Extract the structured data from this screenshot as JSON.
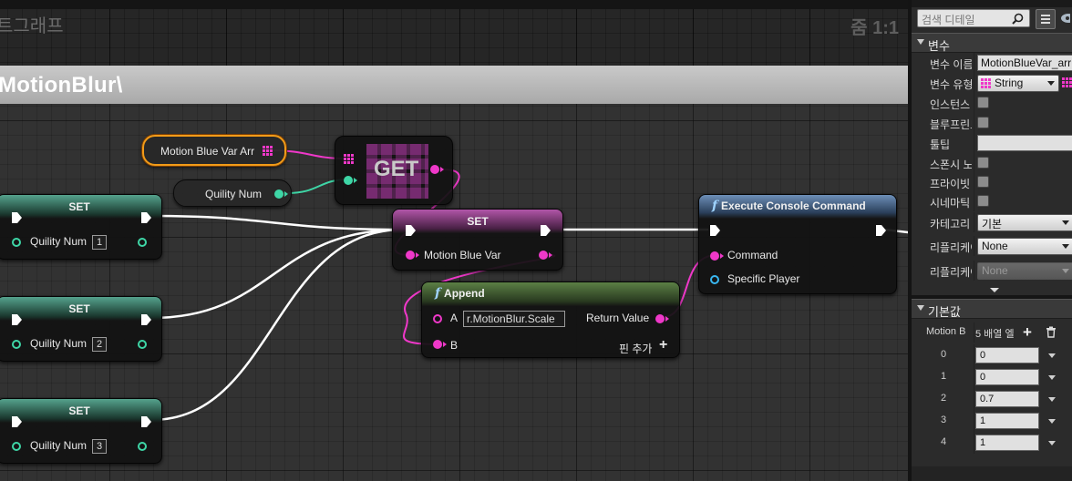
{
  "graph": {
    "title": "트그래프",
    "zoom": "줌 1:1",
    "comment": "MotionBlur\\"
  },
  "nodes": {
    "motion_var": {
      "label": "Motion Blue Var Arr"
    },
    "quility_var": {
      "label": "Quility Num"
    },
    "get": {
      "label": "GET"
    },
    "set1": {
      "title": "SET",
      "pin": "Quility Num",
      "value": "1"
    },
    "set2": {
      "title": "SET",
      "pin": "Quility Num",
      "value": "2"
    },
    "set3": {
      "title": "SET",
      "pin": "Quility Num",
      "value": "3"
    },
    "set_main": {
      "title": "SET",
      "pin": "Motion Blue Var"
    },
    "append": {
      "title": "Append",
      "pin_a": "A",
      "a_value": "r.MotionBlur.Scale",
      "pin_b": "B",
      "return_label": "Return Value",
      "add_pin": "핀 추가"
    },
    "console": {
      "title": "Execute Console Command",
      "command": "Command",
      "player": "Specific Player"
    }
  },
  "details": {
    "search_placeholder": "검색 디테일",
    "variable_section": "변수",
    "rows": [
      {
        "label": "변수 이름",
        "value": "MotionBlueVar_arr"
      },
      {
        "label": "변수 유형",
        "value": "String"
      },
      {
        "label": "인스턴스"
      },
      {
        "label": "블루프린트"
      },
      {
        "label": "툴팁"
      },
      {
        "label": "스폰시 노"
      },
      {
        "label": "프라이빗"
      },
      {
        "label": "시네마틱"
      },
      {
        "label": "카테고리",
        "value": "기본"
      },
      {
        "label": "리플리케이",
        "value": "None"
      },
      {
        "label": "리플리케이",
        "value": "None"
      }
    ],
    "default_section": "기본값",
    "array_label": "Motion B",
    "array_count": "5 배열 엘",
    "array_items": [
      {
        "index": "0",
        "value": "0"
      },
      {
        "index": "1",
        "value": "0"
      },
      {
        "index": "2",
        "value": "0.7"
      },
      {
        "index": "3",
        "value": "1"
      },
      {
        "index": "4",
        "value": "1"
      }
    ]
  },
  "colors": {
    "exec": "#ffffff",
    "float": "#3ed6a6",
    "string": "#ef38c9",
    "object": "#39b7f0",
    "selection": "#f29b18"
  }
}
